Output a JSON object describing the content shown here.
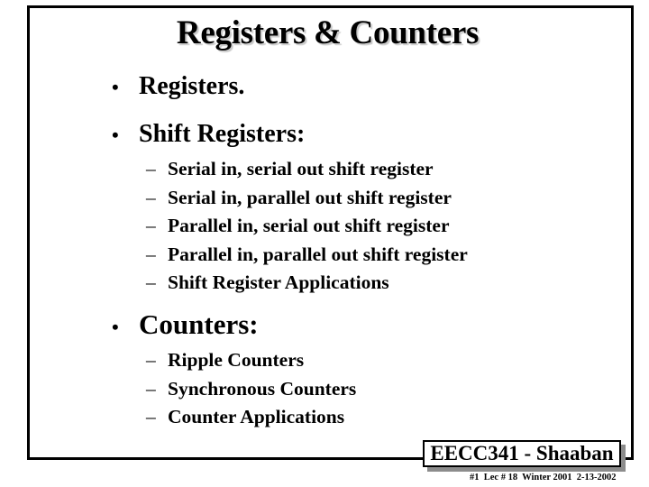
{
  "slide": {
    "title": "Registers & Counters",
    "bullets": [
      {
        "label": "Registers.",
        "sub_items": []
      },
      {
        "label": "Shift Registers:",
        "sub_items": [
          "Serial in, serial out shift register",
          "Serial in, parallel out shift register",
          "Parallel in, serial out shift register",
          "Parallel in, parallel out shift register",
          "Shift Register Applications"
        ]
      },
      {
        "label": "Counters:",
        "sub_items": [
          "Ripple Counters",
          "Synchronous Counters",
          "Counter Applications"
        ]
      }
    ],
    "bullet_glyph": "•",
    "dash_glyph": "–"
  },
  "footer": {
    "course_label": "EECC341 - Shaaban",
    "meta": "#1  Lec # 18  Winter 2001  2-13-2002"
  }
}
